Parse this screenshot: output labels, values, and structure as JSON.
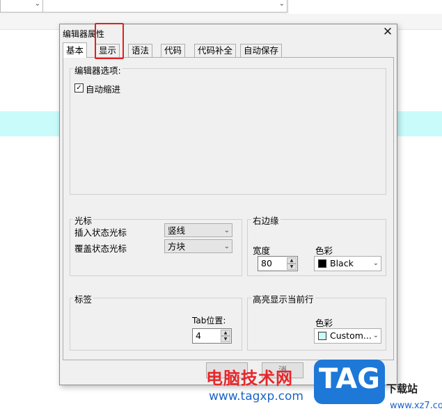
{
  "dialog": {
    "title": "编辑器属性",
    "close_glyph": "✕"
  },
  "tabs": [
    {
      "label": "基本",
      "active": true
    },
    {
      "label": "显示",
      "active": false
    },
    {
      "label": "语法",
      "active": false
    },
    {
      "label": "代码",
      "active": false
    },
    {
      "label": "代码补全",
      "active": false
    },
    {
      "label": "自动保存",
      "active": false
    }
  ],
  "editor_options": {
    "legend": "编辑器选项:",
    "auto_indent": {
      "label": "自动缩进",
      "checked": true,
      "check_glyph": "✓"
    }
  },
  "cursor": {
    "legend": "光标",
    "insert_label": "插入状态光标",
    "insert_value": "竖线",
    "overwrite_label": "覆盖状态光标",
    "overwrite_value": "方块"
  },
  "right_margin": {
    "legend": "右边缘",
    "width_label": "宽度",
    "width_value": "80",
    "color_label": "色彩",
    "color_value": "Black",
    "color_swatch": "#000000"
  },
  "tabs_group": {
    "legend": "标签",
    "tab_pos_label": "Tab位置:",
    "tab_pos_value": "4"
  },
  "highlight_line": {
    "legend": "高亮显示当前行",
    "color_label": "色彩",
    "color_value": "Custom...",
    "color_swatch": "#c9fbfb"
  },
  "footer": {
    "partial_button": "消"
  },
  "watermark": {
    "site_name": "电脑技术网",
    "url": "www.tagxp.com",
    "logo": "TAG",
    "xz_label": "下载站",
    "xz_url": "www.xz7.com"
  },
  "colors": {
    "highlight_box": "#e02020",
    "bg_highlight": "#c9fbfb"
  }
}
